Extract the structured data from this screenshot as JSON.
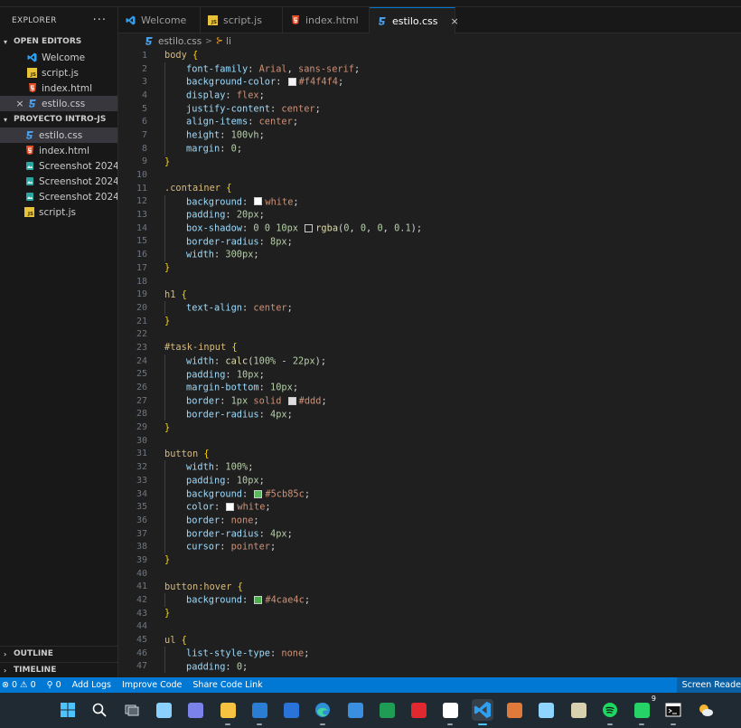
{
  "sidebar": {
    "explorer_title": "EXPLORER",
    "more_label": "···",
    "open_editors": {
      "title": "OPEN EDITORS",
      "items": [
        {
          "name": "Welcome",
          "icon": "vscode-icon"
        },
        {
          "name": "script.js",
          "icon": "js-file-icon"
        },
        {
          "name": "index.html",
          "icon": "html-file-icon"
        },
        {
          "name": "estilo.css",
          "icon": "css-file-icon"
        }
      ],
      "close_glyph": "×"
    },
    "project": {
      "title": "PROYECTO INTRO-JS",
      "items": [
        {
          "name": "estilo.css",
          "icon": "css-file-icon"
        },
        {
          "name": "index.html",
          "icon": "html-file-icon"
        },
        {
          "name": "Screenshot 2024-...",
          "icon": "image-file-icon"
        },
        {
          "name": "Screenshot 2024-...",
          "icon": "image-file-icon"
        },
        {
          "name": "Screenshot 2024-...",
          "icon": "image-file-icon"
        },
        {
          "name": "script.js",
          "icon": "js-file-icon"
        }
      ]
    },
    "outline_label": "OUTLINE",
    "timeline_label": "TIMELINE"
  },
  "tabs": [
    {
      "label": "Welcome",
      "icon": "vscode-icon"
    },
    {
      "label": "script.js",
      "icon": "js-file-icon"
    },
    {
      "label": "index.html",
      "icon": "html-file-icon"
    },
    {
      "label": "estilo.css",
      "icon": "css-file-icon",
      "close": "×"
    }
  ],
  "breadcrumb": {
    "file": "estilo.css",
    "separator": ">",
    "symbol": "li",
    "symbol_glyph": "⊱"
  },
  "editor": {
    "lines": [
      [
        [
          "sel",
          "body"
        ],
        [
          "plain",
          " "
        ],
        [
          "brace",
          "{"
        ]
      ],
      [
        [
          "ind",
          ""
        ],
        [
          "prop",
          "font-family"
        ],
        [
          "plain",
          ": "
        ],
        [
          "val",
          "Arial"
        ],
        [
          "plain",
          ", "
        ],
        [
          "val",
          "sans-serif"
        ],
        [
          "plain",
          ";"
        ]
      ],
      [
        [
          "ind",
          ""
        ],
        [
          "prop",
          "background-color"
        ],
        [
          "plain",
          ": "
        ],
        [
          "sw",
          "#f4f4f4"
        ],
        [
          "val",
          "#f4f4f4"
        ],
        [
          "plain",
          ";"
        ]
      ],
      [
        [
          "ind",
          ""
        ],
        [
          "prop",
          "display"
        ],
        [
          "plain",
          ": "
        ],
        [
          "val",
          "flex"
        ],
        [
          "plain",
          ";"
        ]
      ],
      [
        [
          "ind",
          ""
        ],
        [
          "prop",
          "justify-content"
        ],
        [
          "plain",
          ": "
        ],
        [
          "val",
          "center"
        ],
        [
          "plain",
          ";"
        ]
      ],
      [
        [
          "ind",
          ""
        ],
        [
          "prop",
          "align-items"
        ],
        [
          "plain",
          ": "
        ],
        [
          "val",
          "center"
        ],
        [
          "plain",
          ";"
        ]
      ],
      [
        [
          "ind",
          ""
        ],
        [
          "prop",
          "height"
        ],
        [
          "plain",
          ": "
        ],
        [
          "num",
          "100vh"
        ],
        [
          "plain",
          ";"
        ]
      ],
      [
        [
          "ind",
          ""
        ],
        [
          "prop",
          "margin"
        ],
        [
          "plain",
          ": "
        ],
        [
          "num",
          "0"
        ],
        [
          "plain",
          ";"
        ]
      ],
      [
        [
          "brace",
          "}"
        ]
      ],
      [],
      [
        [
          "sel",
          ".container"
        ],
        [
          "plain",
          " "
        ],
        [
          "brace",
          "{"
        ]
      ],
      [
        [
          "ind",
          ""
        ],
        [
          "prop",
          "background"
        ],
        [
          "plain",
          ": "
        ],
        [
          "sw",
          "#ffffff"
        ],
        [
          "val",
          "white"
        ],
        [
          "plain",
          ";"
        ]
      ],
      [
        [
          "ind",
          ""
        ],
        [
          "prop",
          "padding"
        ],
        [
          "plain",
          ": "
        ],
        [
          "num",
          "20px"
        ],
        [
          "plain",
          ";"
        ]
      ],
      [
        [
          "ind",
          ""
        ],
        [
          "prop",
          "box-shadow"
        ],
        [
          "plain",
          ": "
        ],
        [
          "num",
          "0 0 10px"
        ],
        [
          "plain",
          " "
        ],
        [
          "sw",
          "rgba(0,0,0,0.1)"
        ],
        [
          "fn",
          "rgba"
        ],
        [
          "plain",
          "("
        ],
        [
          "num",
          "0"
        ],
        [
          "plain",
          ", "
        ],
        [
          "num",
          "0"
        ],
        [
          "plain",
          ", "
        ],
        [
          "num",
          "0"
        ],
        [
          "plain",
          ", "
        ],
        [
          "num",
          "0.1"
        ],
        [
          "plain",
          ");"
        ]
      ],
      [
        [
          "ind",
          ""
        ],
        [
          "prop",
          "border-radius"
        ],
        [
          "plain",
          ": "
        ],
        [
          "num",
          "8px"
        ],
        [
          "plain",
          ";"
        ]
      ],
      [
        [
          "ind",
          ""
        ],
        [
          "prop",
          "width"
        ],
        [
          "plain",
          ": "
        ],
        [
          "num",
          "300px"
        ],
        [
          "plain",
          ";"
        ]
      ],
      [
        [
          "brace",
          "}"
        ]
      ],
      [],
      [
        [
          "sel",
          "h1"
        ],
        [
          "plain",
          " "
        ],
        [
          "brace",
          "{"
        ]
      ],
      [
        [
          "ind",
          ""
        ],
        [
          "prop",
          "text-align"
        ],
        [
          "plain",
          ": "
        ],
        [
          "val",
          "center"
        ],
        [
          "plain",
          ";"
        ]
      ],
      [
        [
          "brace",
          "}"
        ]
      ],
      [],
      [
        [
          "sel",
          "#task-input"
        ],
        [
          "plain",
          " "
        ],
        [
          "brace",
          "{"
        ]
      ],
      [
        [
          "ind",
          ""
        ],
        [
          "prop",
          "width"
        ],
        [
          "plain",
          ": "
        ],
        [
          "fn",
          "calc"
        ],
        [
          "plain",
          "("
        ],
        [
          "num",
          "100%"
        ],
        [
          "plain",
          " - "
        ],
        [
          "num",
          "22px"
        ],
        [
          "plain",
          ");"
        ]
      ],
      [
        [
          "ind",
          ""
        ],
        [
          "prop",
          "padding"
        ],
        [
          "plain",
          ": "
        ],
        [
          "num",
          "10px"
        ],
        [
          "plain",
          ";"
        ]
      ],
      [
        [
          "ind",
          ""
        ],
        [
          "prop",
          "margin-bottom"
        ],
        [
          "plain",
          ": "
        ],
        [
          "num",
          "10px"
        ],
        [
          "plain",
          ";"
        ]
      ],
      [
        [
          "ind",
          ""
        ],
        [
          "prop",
          "border"
        ],
        [
          "plain",
          ": "
        ],
        [
          "num",
          "1px"
        ],
        [
          "plain",
          " "
        ],
        [
          "val",
          "solid"
        ],
        [
          "plain",
          " "
        ],
        [
          "sw",
          "#dddddd"
        ],
        [
          "val",
          "#ddd"
        ],
        [
          "plain",
          ";"
        ]
      ],
      [
        [
          "ind",
          ""
        ],
        [
          "prop",
          "border-radius"
        ],
        [
          "plain",
          ": "
        ],
        [
          "num",
          "4px"
        ],
        [
          "plain",
          ";"
        ]
      ],
      [
        [
          "brace",
          "}"
        ]
      ],
      [],
      [
        [
          "sel",
          "button"
        ],
        [
          "plain",
          " "
        ],
        [
          "brace",
          "{"
        ]
      ],
      [
        [
          "ind",
          ""
        ],
        [
          "prop",
          "width"
        ],
        [
          "plain",
          ": "
        ],
        [
          "num",
          "100%"
        ],
        [
          "plain",
          ";"
        ]
      ],
      [
        [
          "ind",
          ""
        ],
        [
          "prop",
          "padding"
        ],
        [
          "plain",
          ": "
        ],
        [
          "num",
          "10px"
        ],
        [
          "plain",
          ";"
        ]
      ],
      [
        [
          "ind",
          ""
        ],
        [
          "prop",
          "background"
        ],
        [
          "plain",
          ": "
        ],
        [
          "sw",
          "#5cb85c"
        ],
        [
          "val",
          "#5cb85c"
        ],
        [
          "plain",
          ";"
        ]
      ],
      [
        [
          "ind",
          ""
        ],
        [
          "prop",
          "color"
        ],
        [
          "plain",
          ": "
        ],
        [
          "sw",
          "#ffffff"
        ],
        [
          "val",
          "white"
        ],
        [
          "plain",
          ";"
        ]
      ],
      [
        [
          "ind",
          ""
        ],
        [
          "prop",
          "border"
        ],
        [
          "plain",
          ": "
        ],
        [
          "val",
          "none"
        ],
        [
          "plain",
          ";"
        ]
      ],
      [
        [
          "ind",
          ""
        ],
        [
          "prop",
          "border-radius"
        ],
        [
          "plain",
          ": "
        ],
        [
          "num",
          "4px"
        ],
        [
          "plain",
          ";"
        ]
      ],
      [
        [
          "ind",
          ""
        ],
        [
          "prop",
          "cursor"
        ],
        [
          "plain",
          ": "
        ],
        [
          "val",
          "pointer"
        ],
        [
          "plain",
          ";"
        ]
      ],
      [
        [
          "brace",
          "}"
        ]
      ],
      [],
      [
        [
          "sel",
          "button:hover"
        ],
        [
          "plain",
          " "
        ],
        [
          "brace",
          "{"
        ]
      ],
      [
        [
          "ind",
          ""
        ],
        [
          "prop",
          "background"
        ],
        [
          "plain",
          ": "
        ],
        [
          "sw",
          "#4cae4c"
        ],
        [
          "val",
          "#4cae4c"
        ],
        [
          "plain",
          ";"
        ]
      ],
      [
        [
          "brace",
          "}"
        ]
      ],
      [],
      [
        [
          "sel",
          "ul"
        ],
        [
          "plain",
          " "
        ],
        [
          "brace",
          "{"
        ]
      ],
      [
        [
          "ind",
          ""
        ],
        [
          "prop",
          "list-style-type"
        ],
        [
          "plain",
          ": "
        ],
        [
          "val",
          "none"
        ],
        [
          "plain",
          ";"
        ]
      ],
      [
        [
          "ind",
          ""
        ],
        [
          "prop",
          "padding"
        ],
        [
          "plain",
          ": "
        ],
        [
          "num",
          "0"
        ],
        [
          "plain",
          ";"
        ]
      ]
    ]
  },
  "statusbar": {
    "errors": "⊗ 0 ⚠ 0",
    "ports": "⚲ 0",
    "add_logs": "Add Logs",
    "improve_code": "Improve Code",
    "share_code_link": "Share Code Link",
    "screen_reader": "Screen Reade"
  },
  "taskbar": {
    "apps": [
      {
        "name": "windows-start-icon",
        "color": "#4cc2ff"
      },
      {
        "name": "search-icon",
        "color": "#ffffff"
      },
      {
        "name": "task-view-icon",
        "color": "#cfd8dc"
      },
      {
        "name": "copilot-icon",
        "color": "#8bd1ff"
      },
      {
        "name": "teams-icon",
        "color": "#7b83eb"
      },
      {
        "name": "file-explorer-icon",
        "color": "#f5c242"
      },
      {
        "name": "word-icon",
        "color": "#2b7cd3"
      },
      {
        "name": "store-icon",
        "color": "#2a73d9"
      },
      {
        "name": "edge-icon",
        "color": "#36b9a8"
      },
      {
        "name": "mail-icon",
        "color": "#3a8fe0"
      },
      {
        "name": "excel-icon",
        "color": "#1f9d55"
      },
      {
        "name": "opera-icon",
        "color": "#e0282e"
      },
      {
        "name": "code-editor-icon",
        "color": "#ffffff"
      },
      {
        "name": "vscode-icon",
        "color": "#2f9ff0"
      },
      {
        "name": "git-icon",
        "color": "#e07a3a"
      },
      {
        "name": "cube-icon",
        "color": "#8fd3ff"
      },
      {
        "name": "scanner-icon",
        "color": "#d9d0b0"
      },
      {
        "name": "spotify-icon",
        "color": "#1ed760"
      },
      {
        "name": "whatsapp-icon",
        "color": "#25d366",
        "badge": "9"
      },
      {
        "name": "terminal-icon",
        "color": "#ffffff"
      },
      {
        "name": "weather-icon",
        "color": "#f7b733"
      }
    ]
  },
  "colors": {
    "accent": "#0078d4",
    "statusbar": "#0078d4",
    "editor_bg": "#1f1f1f",
    "sidebar_bg": "#181818"
  }
}
